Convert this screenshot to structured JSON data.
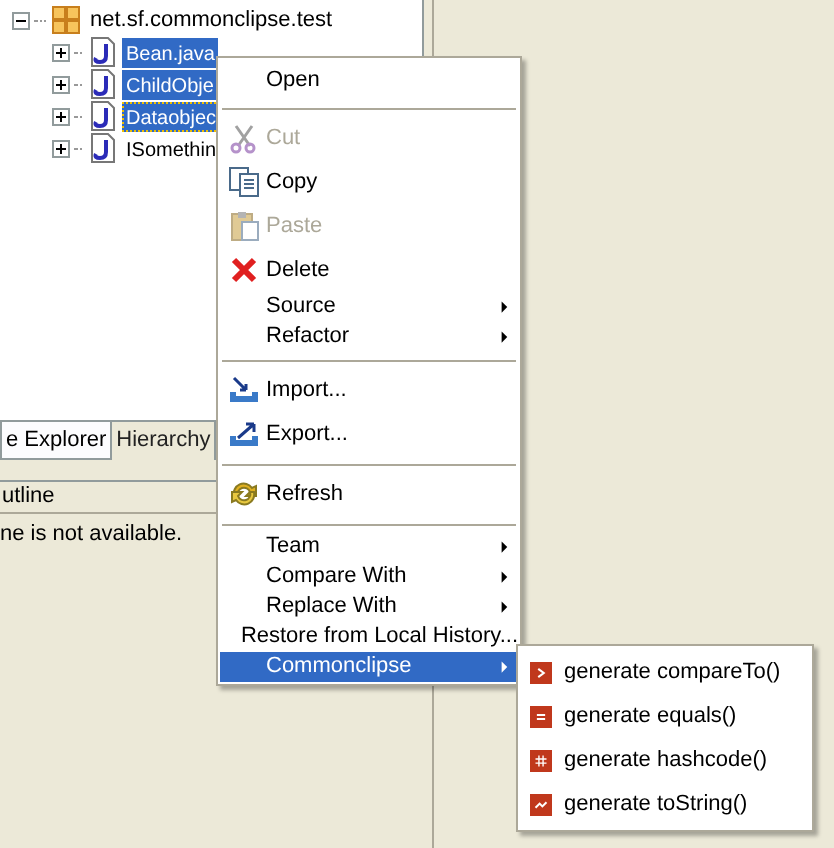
{
  "tree": {
    "root": {
      "label": "net.sf.commonclipse.test",
      "expanded": true,
      "children": [
        {
          "label": "Bean.java",
          "selected": true,
          "focused": false,
          "expanded": false
        },
        {
          "label": "ChildObje",
          "selected": true,
          "focused": false,
          "expanded": false
        },
        {
          "label": "Dataobjec",
          "selected": true,
          "focused": true,
          "expanded": false
        },
        {
          "label": "ISomethin",
          "selected": false,
          "focused": false,
          "expanded": false
        }
      ]
    }
  },
  "tabs": [
    {
      "label": "e Explorer",
      "selected": true
    },
    {
      "label": "Hierarchy",
      "selected": false
    }
  ],
  "outline": {
    "title": "utline",
    "message": "ne is not available."
  },
  "context_menu": {
    "items": [
      {
        "kind": "item",
        "label": "Open",
        "disabled": false,
        "submenu": false,
        "selected": false
      },
      {
        "kind": "separator"
      },
      {
        "kind": "item",
        "label": "Cut",
        "disabled": true,
        "submenu": false,
        "selected": false
      },
      {
        "kind": "item",
        "label": "Copy",
        "disabled": false,
        "submenu": false,
        "selected": false
      },
      {
        "kind": "item",
        "label": "Paste",
        "disabled": true,
        "submenu": false,
        "selected": false
      },
      {
        "kind": "item",
        "label": "Delete",
        "disabled": false,
        "submenu": false,
        "selected": false
      },
      {
        "kind": "item",
        "label": "Source",
        "disabled": false,
        "submenu": true,
        "selected": false
      },
      {
        "kind": "item",
        "label": "Refactor",
        "disabled": false,
        "submenu": true,
        "selected": false
      },
      {
        "kind": "separator"
      },
      {
        "kind": "item",
        "label": "Import...",
        "disabled": false,
        "submenu": false,
        "selected": false
      },
      {
        "kind": "item",
        "label": "Export...",
        "disabled": false,
        "submenu": false,
        "selected": false
      },
      {
        "kind": "separator"
      },
      {
        "kind": "item",
        "label": "Refresh",
        "disabled": false,
        "submenu": false,
        "selected": false
      },
      {
        "kind": "separator"
      },
      {
        "kind": "item",
        "label": "Team",
        "disabled": false,
        "submenu": true,
        "selected": false
      },
      {
        "kind": "item",
        "label": "Compare With",
        "disabled": false,
        "submenu": true,
        "selected": false
      },
      {
        "kind": "item",
        "label": "Replace With",
        "disabled": false,
        "submenu": true,
        "selected": false
      },
      {
        "kind": "item",
        "label": "Restore from Local History...",
        "disabled": false,
        "submenu": false,
        "selected": false
      },
      {
        "kind": "item",
        "label": "Commonclipse",
        "disabled": false,
        "submenu": true,
        "selected": true
      }
    ]
  },
  "submenu": {
    "items": [
      {
        "label": "generate compareTo()"
      },
      {
        "label": "generate equals()"
      },
      {
        "label": "generate hashcode()"
      },
      {
        "label": "generate toString()"
      }
    ]
  }
}
